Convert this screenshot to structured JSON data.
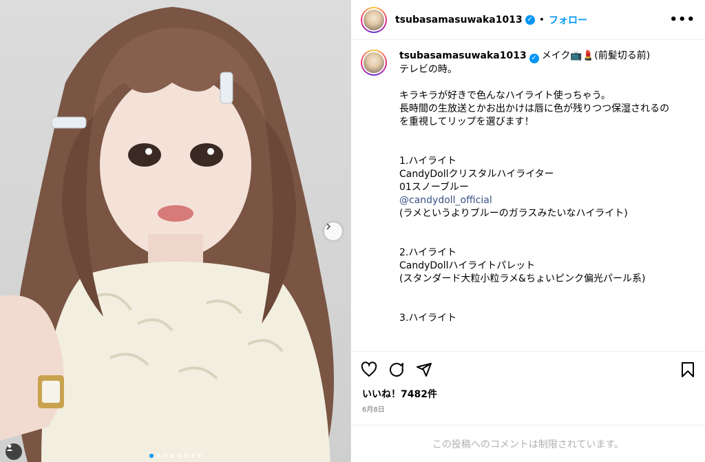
{
  "post": {
    "username": "tsubasamasuwaka1013",
    "separator": "•",
    "follow_label": "フォロー",
    "more_label": "•••",
    "verified_icon": "verified-badge-icon",
    "caption_title": "メイク📺💄(前髪切る前)",
    "caption_lines": [
      "テレビの時。",
      "",
      "キラキラが好きで色んなハイライト使っちゃう。",
      "長時間の生放送とかお出かけは唇に色が残りつつ保湿されるの",
      "を重視してリップを選びます！",
      "",
      "",
      "1.ハイライト",
      "CandyDollクリスタルハイライター",
      "01スノーブルー"
    ],
    "mention": "@candydoll_official",
    "caption_lines_2": [
      "(ラメというよりブルーのガラスみたいなハイライト)",
      "",
      "",
      "2.ハイライト",
      "CandyDollハイライトパレット",
      "(スタンダード大粒小粒ラメ&ちょいピンク偏光パール系)",
      "",
      "",
      "3.ハイライト"
    ],
    "likes": "いいね！7482件",
    "date": "6月8日",
    "comments_notice": "この投稿へのコメントは制限されています。",
    "carousel": {
      "count": 8,
      "active_index": 0
    },
    "accent_color": "#0095f6"
  }
}
